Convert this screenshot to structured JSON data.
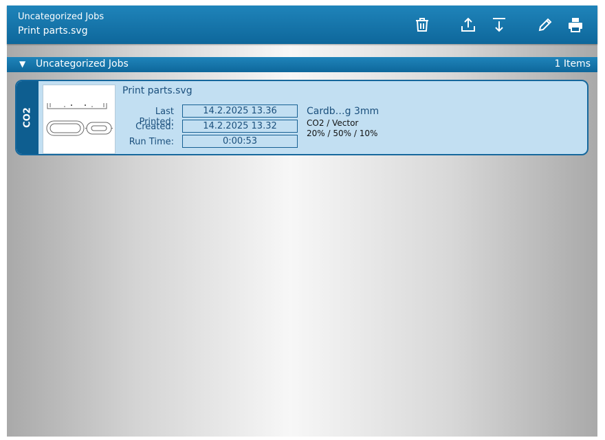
{
  "header": {
    "subtitle": "Uncategorized Jobs",
    "title": "Print parts.svg",
    "toolbar": [
      {
        "name": "delete",
        "icon": "trash-icon"
      },
      {
        "name": "export",
        "icon": "upload-icon"
      },
      {
        "name": "import",
        "icon": "download-icon"
      },
      {
        "name": "edit",
        "icon": "pencil-icon"
      },
      {
        "name": "print",
        "icon": "printer-icon"
      }
    ]
  },
  "group": {
    "name": "Uncategorized Jobs",
    "count": "1 Items"
  },
  "job": {
    "laser_type": "CO2",
    "name": "Print parts.svg",
    "last_printed_label": "Last Printed:",
    "last_printed": "14.2.2025 13.36",
    "created_label": "Created:",
    "created": "14.2.2025 13.32",
    "run_time_label": "Run Time:",
    "run_time": "0:00:53",
    "material": "Cardb…g 3mm",
    "process": "CO2 / Vector",
    "params": "20% / 50% / 10%"
  },
  "colors": {
    "header_blue": "#0e679b",
    "card_bg": "#c2dff2",
    "card_border": "#15679c",
    "text_blue": "#1a4f7c"
  }
}
